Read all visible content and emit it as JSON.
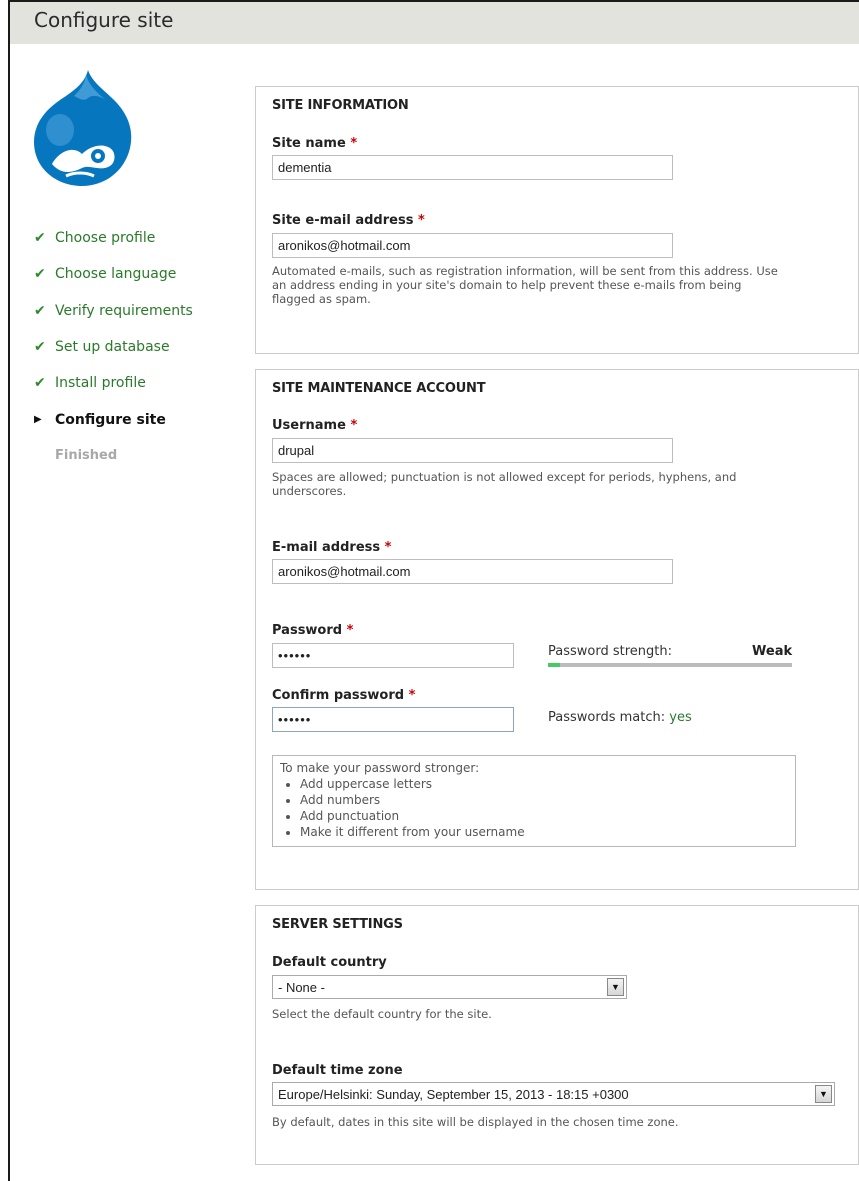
{
  "window": {
    "title": "Configure site"
  },
  "steps": [
    {
      "label": "Choose profile",
      "state": "done"
    },
    {
      "label": "Choose language",
      "state": "done"
    },
    {
      "label": "Verify requirements",
      "state": "done"
    },
    {
      "label": "Set up database",
      "state": "done"
    },
    {
      "label": "Install profile",
      "state": "done"
    },
    {
      "label": "Configure site",
      "state": "active"
    },
    {
      "label": "Finished",
      "state": "pending"
    }
  ],
  "site_information": {
    "legend": "SITE INFORMATION",
    "site_name_label": "Site name",
    "site_name_value": "dementia",
    "site_email_label": "Site e-mail address",
    "site_email_value": "aronikos@hotmail.com",
    "site_email_desc_1": "Automated e-mails, such as registration information, will be sent from this address. Use",
    "site_email_desc_2": "an address ending in your site's domain to help prevent these e-mails from being",
    "site_email_desc_3": "flagged as spam."
  },
  "maintenance_account": {
    "legend": "SITE MAINTENANCE ACCOUNT",
    "username_label": "Username",
    "username_value": "drupal",
    "username_desc_1": "Spaces are allowed; punctuation is not allowed except for periods, hyphens, and",
    "username_desc_2": "underscores.",
    "email_label": "E-mail address",
    "email_value": "aronikos@hotmail.com",
    "password_label": "Password",
    "password_value": "••••••",
    "strength_label": "Password strength:",
    "strength_value": "Weak",
    "strength_fraction": 0.05,
    "confirm_label": "Confirm password",
    "confirm_value": "••••••",
    "match_label": "Passwords match:",
    "match_value": "yes",
    "tips_heading": "To make your password stronger:",
    "tips": [
      "Add uppercase letters",
      "Add numbers",
      "Add punctuation",
      "Make it different from your username"
    ]
  },
  "server_settings": {
    "legend": "SERVER SETTINGS",
    "country_label": "Default country",
    "country_value": "- None -",
    "country_desc": "Select the default country for the site.",
    "timezone_label": "Default time zone",
    "timezone_value": "Europe/Helsinki: Sunday, September 15, 2013 - 18:15 +0300",
    "timezone_desc": "By default, dates in this site will be displayed in the chosen time zone."
  },
  "required_marker": "*",
  "colors": {
    "done": "#2a7a2a",
    "required": "#cc0000",
    "strength_fill": "#47c965",
    "logo_blue": "#0077c0"
  },
  "icons": {
    "done": "check-icon",
    "active": "triangle-right-icon",
    "select": "chevron-down-icon"
  }
}
